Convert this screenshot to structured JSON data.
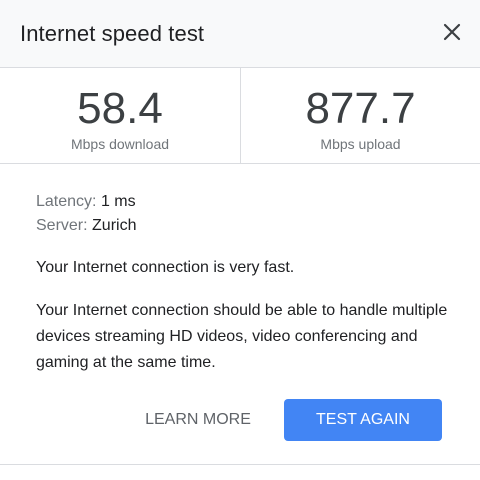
{
  "header": {
    "title": "Internet speed test",
    "close_icon": "close-icon"
  },
  "stats": {
    "download": {
      "value": "58.4",
      "label": "Mbps download"
    },
    "upload": {
      "value": "877.7",
      "label": "Mbps upload"
    }
  },
  "details": {
    "latency_key": "Latency:",
    "latency_value": "1 ms",
    "server_key": "Server:",
    "server_value": "Zurich"
  },
  "verdict": "Your Internet connection is very fast.",
  "description": "Your Internet connection should be able to handle multiple devices streaming HD videos, video conferencing and gaming at the same time.",
  "actions": {
    "learn_more": "LEARN MORE",
    "test_again": "TEST AGAIN"
  },
  "colors": {
    "accent": "#4285f4",
    "header_bg": "#f8f9fa",
    "divider": "#dadce0",
    "secondary_text": "#70757a"
  }
}
